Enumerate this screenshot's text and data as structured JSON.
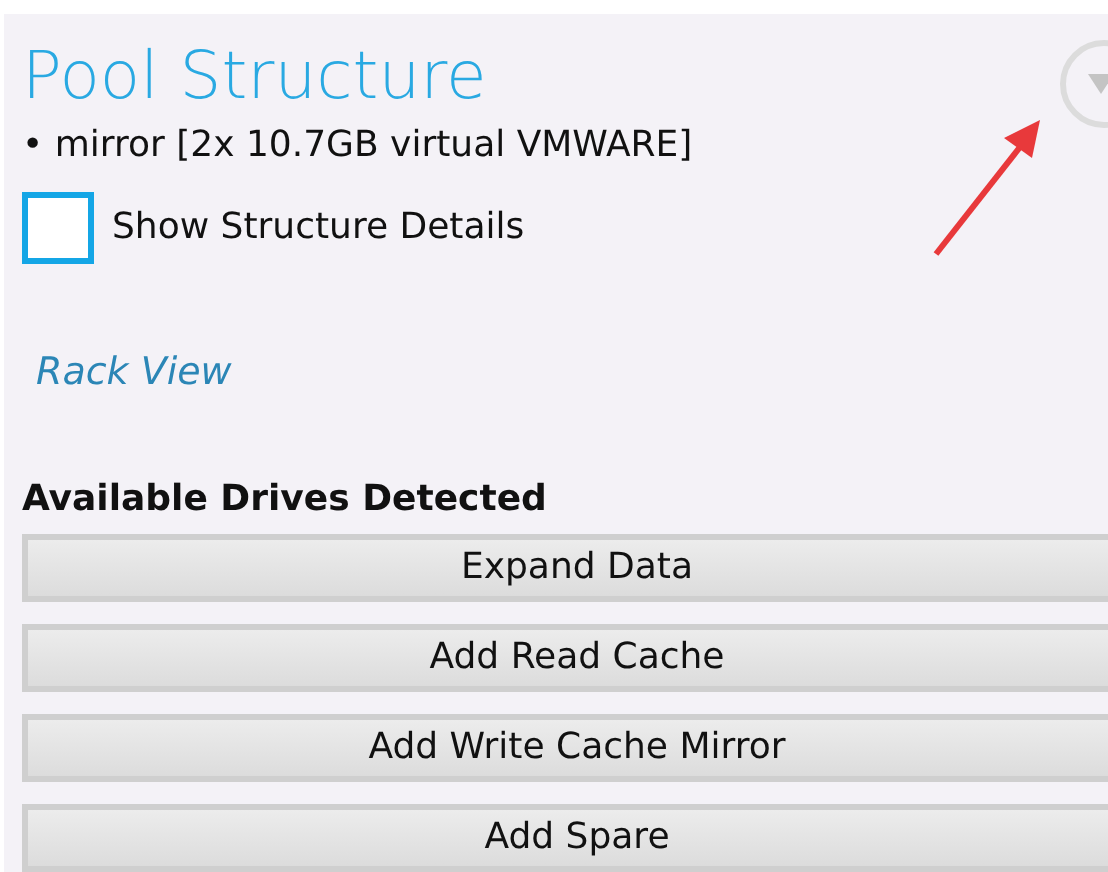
{
  "title": "Pool Structure",
  "pool_items": [
    "• mirror [2x 10.7GB virtual VMWARE]"
  ],
  "show_details": {
    "label": "Show Structure Details",
    "checked": false
  },
  "rack_view_link": "Rack View",
  "drives_heading": "Available Drives Detected",
  "buttons": [
    "Expand Data",
    "Add Read Cache",
    "Add Write Cache Mirror",
    "Add Spare"
  ]
}
